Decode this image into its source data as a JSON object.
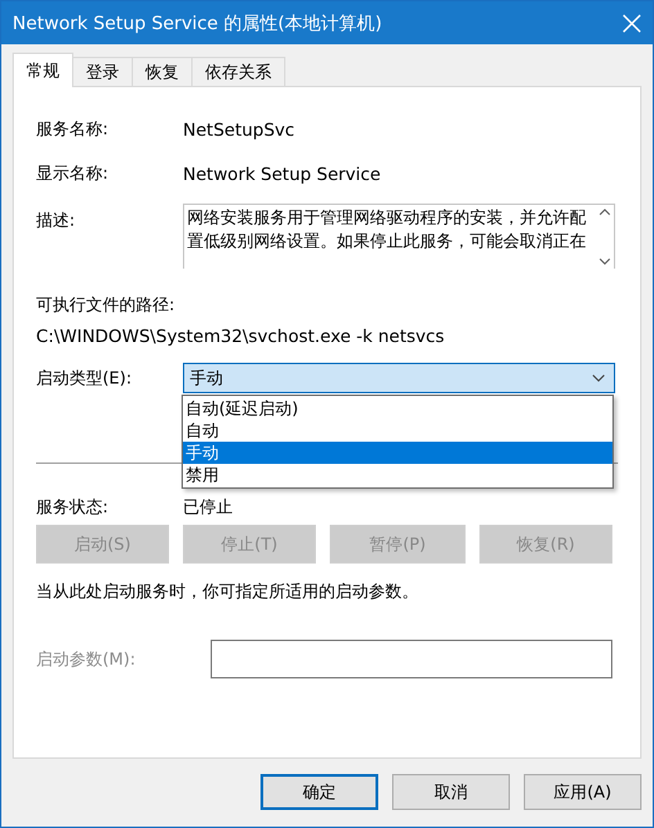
{
  "window": {
    "title": "Network Setup Service 的属性(本地计算机)"
  },
  "tabs": [
    {
      "label": "常规",
      "selected": true
    },
    {
      "label": "登录",
      "selected": false
    },
    {
      "label": "恢复",
      "selected": false
    },
    {
      "label": "依存关系",
      "selected": false
    }
  ],
  "fields": [
    {
      "label": "服务名称:",
      "value": "NetSetupSvc"
    },
    {
      "label": "显示名称:",
      "value": "Network Setup Service"
    }
  ],
  "description": {
    "label": "描述:",
    "text": "网络安装服务用于管理网络驱动程序的安装，并允许配置低级别网络设置。如果停止此服务，可能会取消正在"
  },
  "path": {
    "label": "可执行文件的路径:",
    "value": "C:\\WINDOWS\\System32\\svchost.exe -k netsvcs"
  },
  "startup_type": {
    "label": "启动类型(E):",
    "value": "手动",
    "expanded": true,
    "options": [
      {
        "label": "自动(延迟启动)",
        "selected": false
      },
      {
        "label": "自动",
        "selected": false
      },
      {
        "label": "手动",
        "selected": true
      },
      {
        "label": "禁用",
        "selected": false
      }
    ]
  },
  "service_status": {
    "label": "服务状态:",
    "value": "已停止"
  },
  "service_buttons": [
    {
      "label": "启动(S)",
      "disabled": true
    },
    {
      "label": "停止(T)",
      "disabled": true
    },
    {
      "label": "暂停(P)",
      "disabled": true
    },
    {
      "label": "恢复(R)",
      "disabled": true
    }
  ],
  "hint": "当从此处启动服务时，你可指定所适用的启动参数。",
  "start_parameters": {
    "label": "启动参数(M):",
    "disabled": true
  },
  "buttons": [
    {
      "label": "确定",
      "default": true
    },
    {
      "label": "取消",
      "default": false
    },
    {
      "label": "应用(A)",
      "default": false
    }
  ]
}
